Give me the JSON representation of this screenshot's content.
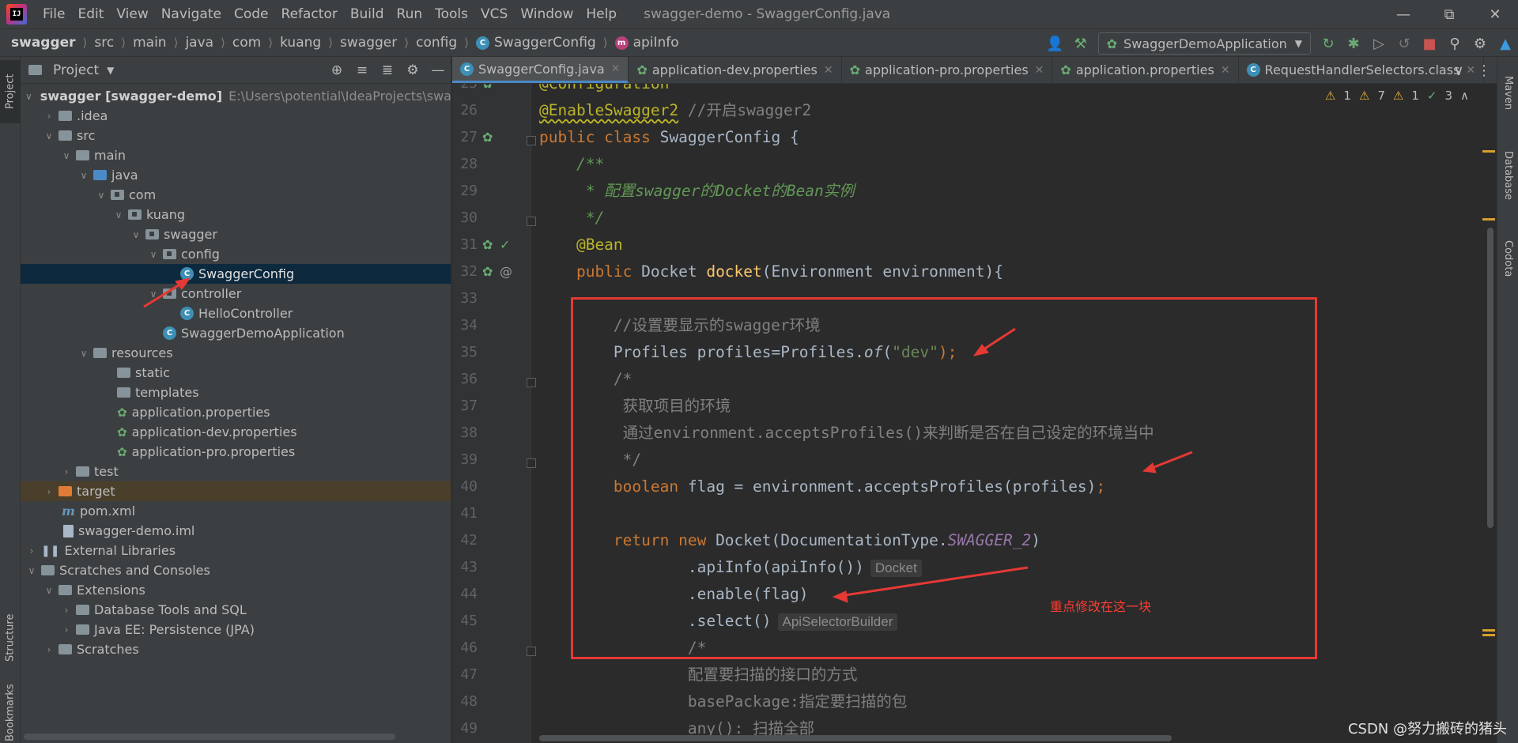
{
  "menubar": {
    "logo_text": "IJ",
    "items": [
      "File",
      "Edit",
      "View",
      "Navigate",
      "Code",
      "Refactor",
      "Build",
      "Run",
      "Tools",
      "VCS",
      "Window",
      "Help"
    ],
    "window_title": "swagger-demo - SwaggerConfig.java"
  },
  "navbar": {
    "crumbs": [
      "swagger",
      "src",
      "main",
      "java",
      "com",
      "kuang",
      "swagger",
      "config",
      "SwaggerConfig",
      "apiInfo"
    ],
    "run_config": "SwaggerDemoApplication"
  },
  "left_stripe": {
    "project": "Project",
    "structure": "Structure",
    "bookmarks": "Bookmarks"
  },
  "right_stripe": {
    "maven": "Maven",
    "database": "Database",
    "codota": "Codota"
  },
  "project_panel": {
    "title": "Project",
    "root_path": "E:\\Users\\potential\\IdeaProjects\\swagger",
    "items": [
      {
        "label": "swagger [swagger-demo]"
      },
      {
        "label": ".idea"
      },
      {
        "label": "src"
      },
      {
        "label": "main"
      },
      {
        "label": "java"
      },
      {
        "label": "com"
      },
      {
        "label": "kuang"
      },
      {
        "label": "swagger"
      },
      {
        "label": "config"
      },
      {
        "label": "SwaggerConfig"
      },
      {
        "label": "controller"
      },
      {
        "label": "HelloController"
      },
      {
        "label": "SwaggerDemoApplication"
      },
      {
        "label": "resources"
      },
      {
        "label": "static"
      },
      {
        "label": "templates"
      },
      {
        "label": "application.properties"
      },
      {
        "label": "application-dev.properties"
      },
      {
        "label": "application-pro.properties"
      },
      {
        "label": "test"
      },
      {
        "label": "target"
      },
      {
        "label": "pom.xml"
      },
      {
        "label": "swagger-demo.iml"
      },
      {
        "label": "External Libraries"
      },
      {
        "label": "Scratches and Consoles"
      },
      {
        "label": "Extensions"
      },
      {
        "label": "Database Tools and SQL"
      },
      {
        "label": "Java EE: Persistence (JPA)"
      },
      {
        "label": "Scratches"
      }
    ]
  },
  "editor_tabs": [
    {
      "label": "SwaggerConfig.java"
    },
    {
      "label": "application-dev.properties"
    },
    {
      "label": "application-pro.properties"
    },
    {
      "label": "application.properties"
    },
    {
      "label": "RequestHandlerSelectors.class"
    }
  ],
  "editor_status": {
    "warn1": "1",
    "warn2": "7",
    "warn3": "1",
    "ok": "3"
  },
  "code": {
    "line_numbers": [
      "25",
      "26",
      "27",
      "28",
      "29",
      "30",
      "31",
      "32",
      "33",
      "34",
      "35",
      "36",
      "37",
      "38",
      "39",
      "40",
      "41",
      "42",
      "43",
      "44",
      "45",
      "46",
      "47",
      "48",
      "49"
    ],
    "l25": "@Configuration",
    "l26_ann": "@EnableSwagger2",
    "l26_cm": " //开启swagger2",
    "l27_kw": "public class",
    "l27_rest": " SwaggerConfig {",
    "l28": "    /**",
    "l29": "     * 配置swagger的Docket的Bean实例",
    "l30": "     */",
    "l31": "    @Bean",
    "l32_kw": "    public",
    "l32_type": " Docket ",
    "l32_fn": "docket",
    "l32_rest": "(Environment environment){",
    "l34": "        //设置要显示的swagger环境",
    "l35_a": "        Profiles profiles=Profiles.",
    "l35_of": "of",
    "l35_b": "(",
    "l35_str": "\"dev\"",
    "l35_c": ");",
    "l36": "        /*",
    "l37": "         获取项目的环境",
    "l38": "         通过environment.acceptsProfiles()来判断是否在自己设定的环境当中",
    "l39": "         */",
    "l40_kw": "        boolean",
    "l40_rest": " flag = environment.acceptsProfiles(profiles)",
    "l40_semi": ";",
    "l42_kw1": "        return new",
    "l42_a": " Docket(DocumentationType.",
    "l42_ps": "SWAGGER_2",
    "l42_b": ")",
    "l43": "                .apiInfo(apiInfo())",
    "l43_hint": "Docket",
    "l44": "                .enable(flag)",
    "l45": "                .select()",
    "l45_hint": "ApiSelectorBuilder",
    "l46": "                /*",
    "l47": "                配置要扫描的接口的方式",
    "l48": "                basePackage:指定要扫描的包",
    "l49": "                any(): 扫描全部"
  },
  "annotation": {
    "text": "重点修改在这一块"
  },
  "watermark": "CSDN @努力搬砖的猪头",
  "colors": {
    "accent_blue": "#4a88c7",
    "highlight_red": "#e53935",
    "keyword": "#cc7832",
    "annotation_yellow": "#bbb529"
  }
}
